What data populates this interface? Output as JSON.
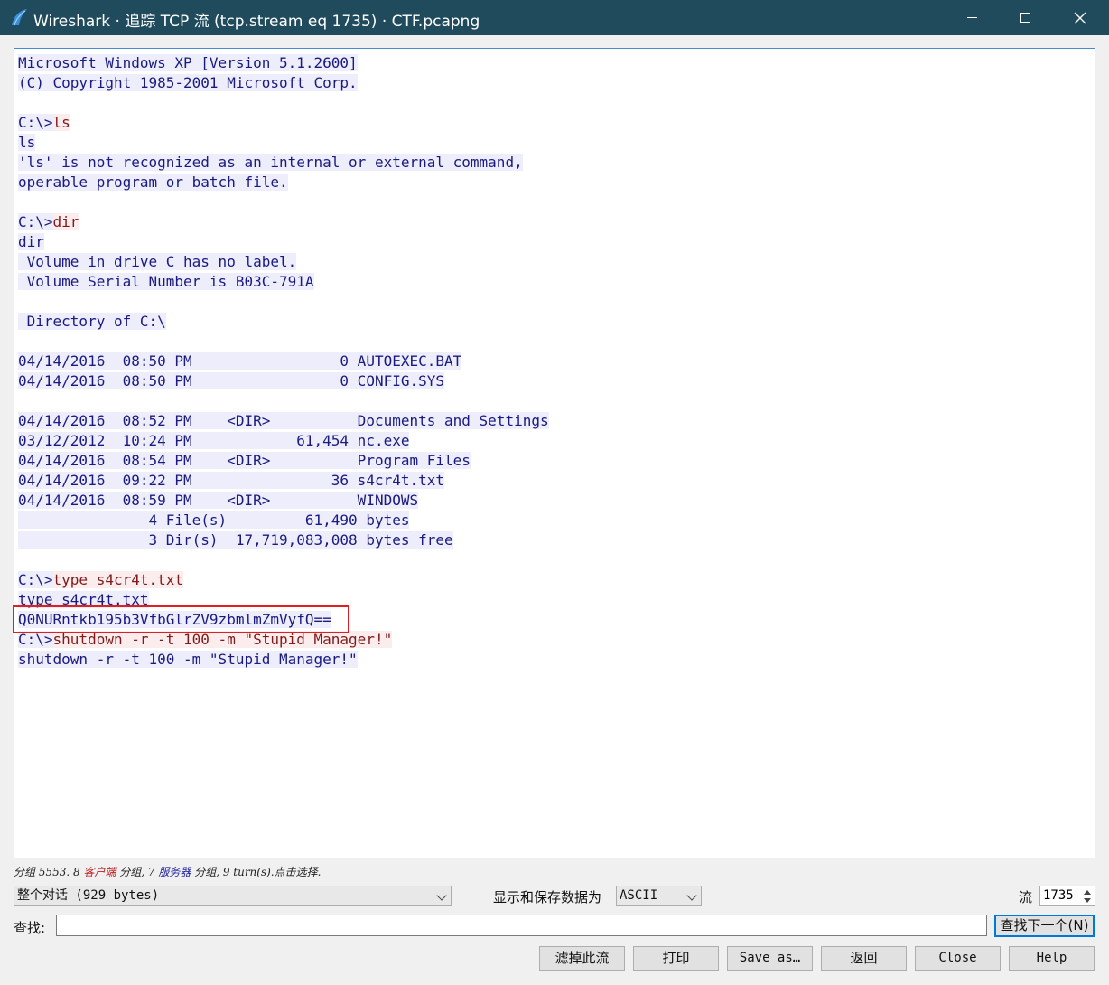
{
  "window": {
    "title": "Wireshark · 追踪 TCP 流 (tcp.stream eq 1735) · CTF.pcapng"
  },
  "stream_lines": [
    [
      {
        "t": "Microsoft Windows XP [Version 5.1.2600]",
        "k": "srv"
      }
    ],
    [
      {
        "t": "(C) Copyright 1985-2001 Microsoft Corp.",
        "k": "srv"
      }
    ],
    [],
    [
      {
        "t": "C:\\>",
        "k": "srv"
      },
      {
        "t": "ls",
        "k": "cli"
      }
    ],
    [
      {
        "t": "ls",
        "k": "srv"
      }
    ],
    [
      {
        "t": "'ls' is not recognized as an internal or external command,",
        "k": "srv"
      }
    ],
    [
      {
        "t": "operable program or batch file.",
        "k": "srv"
      }
    ],
    [],
    [
      {
        "t": "C:\\>",
        "k": "srv"
      },
      {
        "t": "dir",
        "k": "cli"
      }
    ],
    [
      {
        "t": "dir",
        "k": "srv"
      }
    ],
    [
      {
        "t": " Volume in drive C has no label.",
        "k": "srv"
      }
    ],
    [
      {
        "t": " Volume Serial Number is B03C-791A",
        "k": "srv"
      }
    ],
    [],
    [
      {
        "t": " Directory of C:\\",
        "k": "srv"
      }
    ],
    [],
    [
      {
        "t": "04/14/2016  08:50 PM                 0 AUTOEXEC.BAT",
        "k": "srv"
      }
    ],
    [
      {
        "t": "04/14/2016  08:50 PM                 0 CONFIG.SYS",
        "k": "srv"
      }
    ],
    [],
    [
      {
        "t": "04/14/2016  08:52 PM    <DIR>          Documents and Settings",
        "k": "srv"
      }
    ],
    [
      {
        "t": "03/12/2012  10:24 PM            61,454 nc.exe",
        "k": "srv"
      }
    ],
    [
      {
        "t": "04/14/2016  08:54 PM    <DIR>          Program Files",
        "k": "srv"
      }
    ],
    [
      {
        "t": "04/14/2016  09:22 PM                36 s4cr4t.txt",
        "k": "srv"
      }
    ],
    [
      {
        "t": "04/14/2016  08:59 PM    <DIR>          WINDOWS",
        "k": "srv"
      }
    ],
    [
      {
        "t": "               4 File(s)         61,490 bytes",
        "k": "srv"
      }
    ],
    [
      {
        "t": "               3 Dir(s)  17,719,083,008 bytes free",
        "k": "srv"
      }
    ],
    [],
    [
      {
        "t": "C:\\>",
        "k": "srv"
      },
      {
        "t": "type s4cr4t.txt",
        "k": "cli"
      }
    ],
    [
      {
        "t": "type s4cr4t.txt",
        "k": "srv"
      }
    ],
    [
      {
        "t": "Q0NURntkb195b3VfbGlrZV9zbmlmZmVyfQ==",
        "k": "srv"
      }
    ],
    [
      {
        "t": "C:\\>",
        "k": "srv"
      },
      {
        "t": "shutdown -r -t 100 -m \"Stupid Manager!\"",
        "k": "cli"
      }
    ],
    [
      {
        "t": "shutdown -r -t 100 -m \"Stupid Manager!\"",
        "k": "srv"
      }
    ]
  ],
  "status": {
    "part1": "分组 5553. 8 ",
    "client": "客户端",
    "part2": " 分组, 7 ",
    "server": "服务器",
    "part3": " 分组, 9 turn(s).点击选择."
  },
  "controls": {
    "conversation_select": "整个对话 (929 bytes)",
    "show_label": "显示和保存数据为",
    "format_select": "ASCII",
    "stream_label": "流",
    "stream_value": "1735",
    "find_label": "查找:",
    "find_value": "",
    "find_next_label": "查找下一个(N)"
  },
  "buttons": {
    "filter_out": "滤掉此流",
    "print": "打印",
    "save_as": "Save as…",
    "back": "返回",
    "close": "Close",
    "help": "Help"
  },
  "colors": {
    "titlebar": "#1f4b5c",
    "server_bg": "#ededfb",
    "server_fg": "#1a1a80",
    "client_bg": "#fbeded",
    "client_fg": "#801a1a",
    "highlight_border": "#e02020"
  }
}
